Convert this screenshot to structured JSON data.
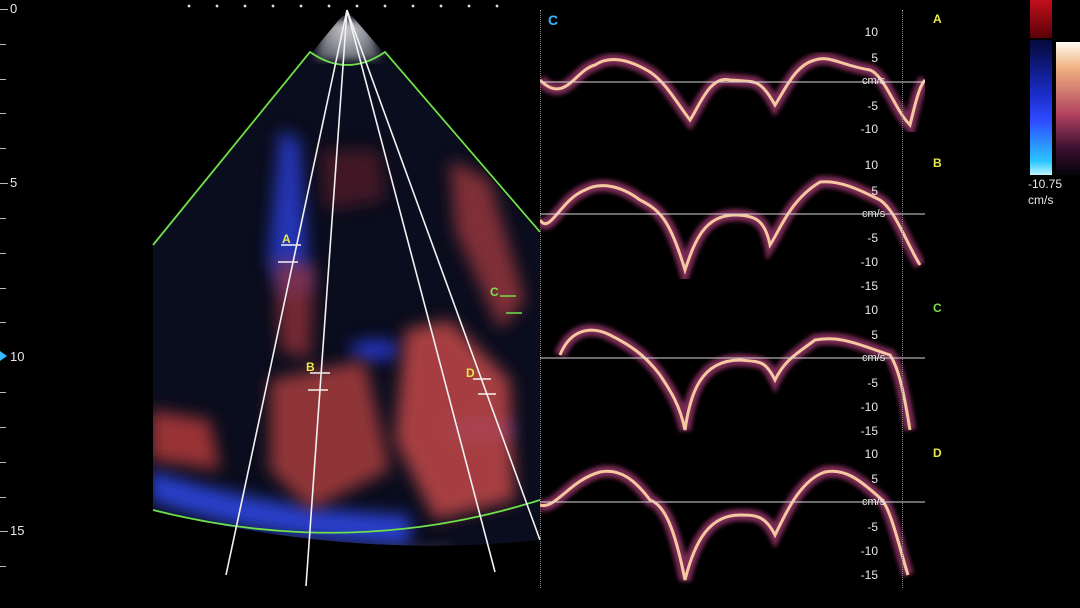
{
  "depth_scale": {
    "labels": [
      "0",
      "5",
      "10",
      "15"
    ],
    "marker_value": "10"
  },
  "sector_labels": {
    "a": "A",
    "b": "B",
    "c": "C",
    "d": "D"
  },
  "trace_panel": {
    "title": "C",
    "unit": "cm/s",
    "traces": [
      {
        "label": "A",
        "ticks": [
          "10",
          "5",
          "-5",
          "-10"
        ]
      },
      {
        "label": "B",
        "ticks": [
          "10",
          "5",
          "-5",
          "-10",
          "-15"
        ]
      },
      {
        "label": "C",
        "ticks": [
          "10",
          "5",
          "-5",
          "-10",
          "-15"
        ]
      },
      {
        "label": "D",
        "ticks": [
          "10",
          "5",
          "-5",
          "-10",
          "-15"
        ]
      }
    ]
  },
  "colorbar": {
    "value": "-10.75",
    "unit": "cm/s"
  },
  "colors": {
    "segment_yellow": "#e8e84a",
    "segment_green": "#7be04a",
    "accent_cyan": "#35b8ff",
    "sector_outline": "#6ee04a"
  }
}
